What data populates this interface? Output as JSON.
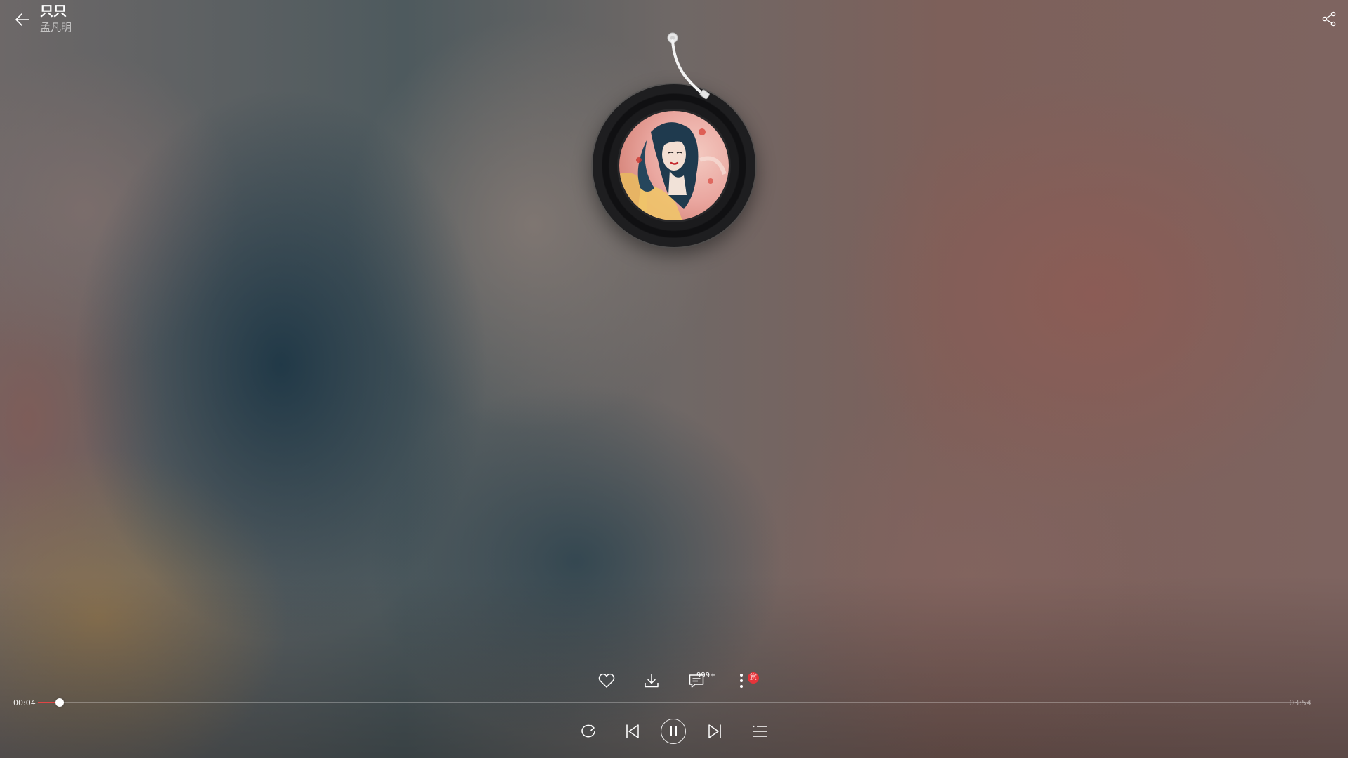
{
  "player": {
    "title": "只只",
    "artist": "孟凡明"
  },
  "actions": {
    "comment_count": "999+",
    "reward_badge": "赏"
  },
  "progress": {
    "current_time": "00:04",
    "total_time": "03:54",
    "fraction": 0.017
  },
  "colors": {
    "accent": "#e04545",
    "badge": "#e6343a"
  },
  "icons": {
    "back": "arrow-left-icon",
    "share": "share-icon",
    "like": "heart-icon",
    "download": "download-icon",
    "comment": "comment-icon",
    "more": "more-vertical-icon",
    "loop": "repeat-icon",
    "previous": "skip-previous-icon",
    "pause": "pause-icon",
    "next": "skip-next-icon",
    "playlist": "playlist-icon"
  }
}
